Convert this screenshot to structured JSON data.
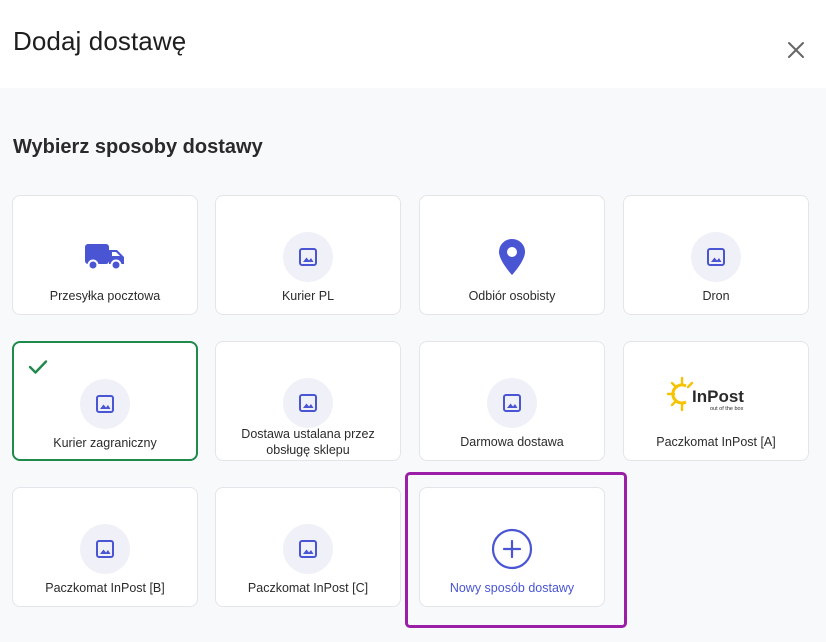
{
  "dialog": {
    "title": "Dodaj dostawę",
    "close_icon": "close-icon"
  },
  "section": {
    "title": "Wybierz sposoby dostawy"
  },
  "options": [
    {
      "label": "Przesyłka pocztowa",
      "icon": "truck-icon",
      "selected": false
    },
    {
      "label": "Kurier PL",
      "icon": "image-placeholder-icon",
      "selected": false
    },
    {
      "label": "Odbiór osobisty",
      "icon": "map-pin-icon",
      "selected": false
    },
    {
      "label": "Dron",
      "icon": "image-placeholder-icon",
      "selected": false
    },
    {
      "label": "Kurier zagraniczny",
      "icon": "image-placeholder-icon",
      "selected": true
    },
    {
      "label": "Dostawa ustalana przez obsługę sklepu",
      "icon": "image-placeholder-icon",
      "selected": false
    },
    {
      "label": "Darmowa dostawa",
      "icon": "image-placeholder-icon",
      "selected": false
    },
    {
      "label": "Paczkomat InPost [A]",
      "icon": "inpost-logo",
      "selected": false
    },
    {
      "label": "Paczkomat InPost [B]",
      "icon": "image-placeholder-icon",
      "selected": false
    },
    {
      "label": "Paczkomat InPost [C]",
      "icon": "image-placeholder-icon",
      "selected": false
    }
  ],
  "new_option": {
    "label": "Nowy sposób dostawy",
    "icon": "plus-circle-icon"
  },
  "inpost_logo": {
    "brand": "InPost",
    "tagline": "out of the box"
  },
  "colors": {
    "accent": "#4a55d4",
    "selected_border": "#1f8a4c",
    "highlight_border": "#9a1fa6",
    "icon_bg": "#f0f1f8"
  }
}
